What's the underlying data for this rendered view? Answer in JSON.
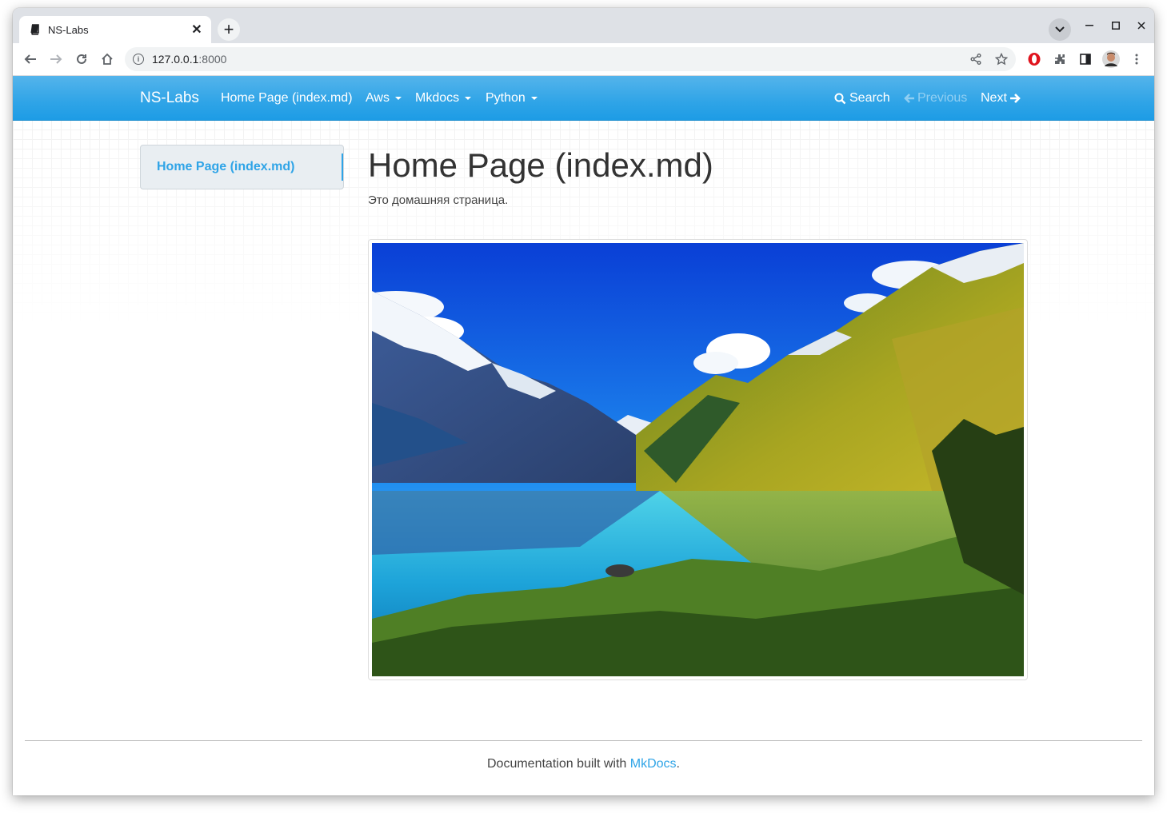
{
  "browser": {
    "tab_title": "NS-Labs",
    "url_host": "127.0.0.1",
    "url_port": ":8000"
  },
  "navbar": {
    "brand": "NS-Labs",
    "items": [
      {
        "label": "Home Page (index.md)"
      },
      {
        "label": "Aws"
      },
      {
        "label": "Mkdocs"
      },
      {
        "label": "Python"
      }
    ],
    "search_label": "Search",
    "previous_label": "Previous",
    "next_label": "Next"
  },
  "sidebar": {
    "items": [
      {
        "label": "Home Page (index.md)"
      }
    ]
  },
  "content": {
    "title": "Home Page (index.md)",
    "text": "Это домашняя страница."
  },
  "footer": {
    "prefix": "Documentation built with ",
    "link": "MkDocs",
    "suffix": "."
  },
  "colors": {
    "accent": "#2fa4e7",
    "navbar": "#2fa4e7",
    "sidebar_bg": "#e9eef2"
  }
}
